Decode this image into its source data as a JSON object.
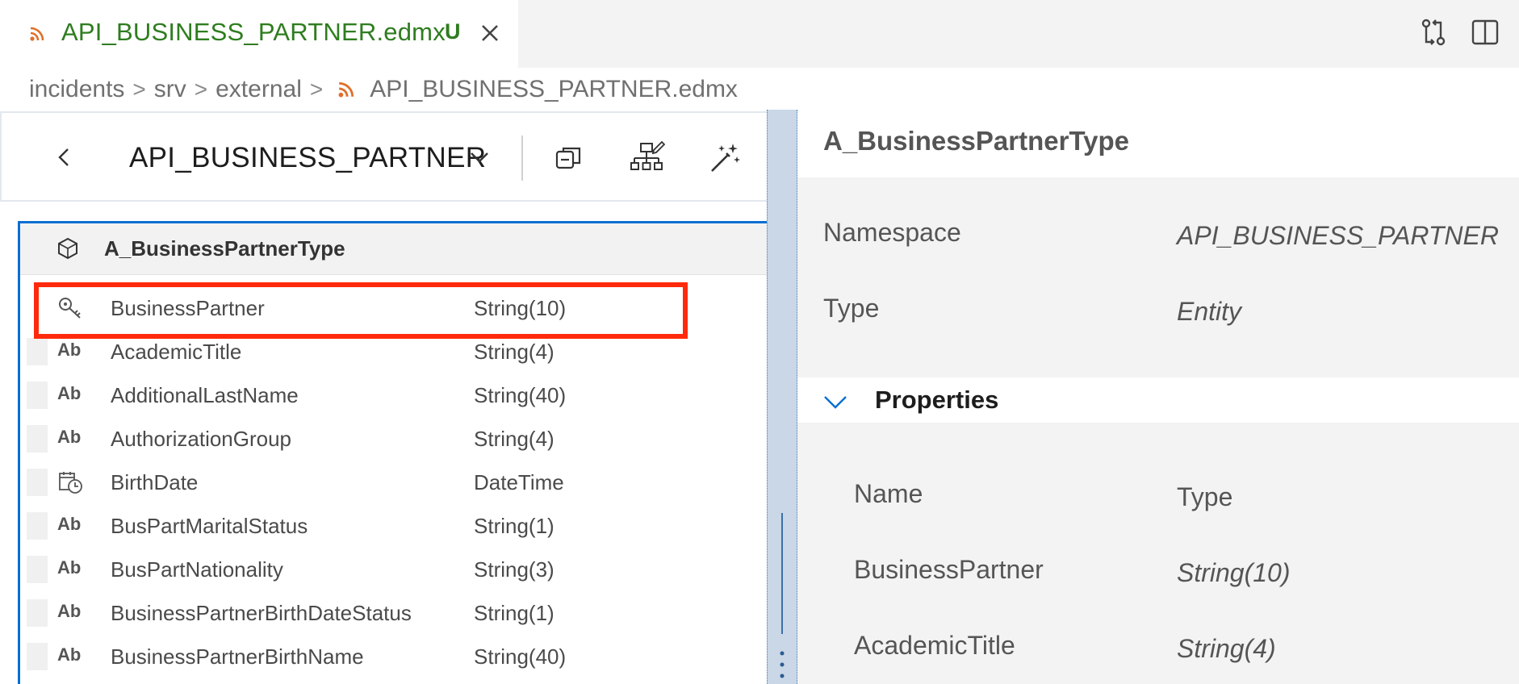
{
  "tab": {
    "title": "API_BUSINESS_PARTNER.edmx",
    "badge": "U"
  },
  "breadcrumb": {
    "items": [
      "incidents",
      "srv",
      "external"
    ],
    "file": "API_BUSINESS_PARTNER.edmx",
    "separator": ">"
  },
  "toolbar": {
    "service_title": "API_BUSINESS_PARTNER"
  },
  "entity": {
    "name": "A_BusinessPartnerType",
    "properties": [
      {
        "name": "BusinessPartner",
        "type": "String(10)",
        "icon": "key-icon"
      },
      {
        "name": "AcademicTitle",
        "type": "String(4)",
        "icon": "Ab"
      },
      {
        "name": "AdditionalLastName",
        "type": "String(40)",
        "icon": "Ab"
      },
      {
        "name": "AuthorizationGroup",
        "type": "String(4)",
        "icon": "Ab"
      },
      {
        "name": "BirthDate",
        "type": "DateTime",
        "icon": "calendar-clock-icon"
      },
      {
        "name": "BusPartMaritalStatus",
        "type": "String(1)",
        "icon": "Ab"
      },
      {
        "name": "BusPartNationality",
        "type": "String(3)",
        "icon": "Ab"
      },
      {
        "name": "BusinessPartnerBirthDateStatus",
        "type": "String(1)",
        "icon": "Ab"
      },
      {
        "name": "BusinessPartnerBirthName",
        "type": "String(40)",
        "icon": "Ab"
      }
    ]
  },
  "details": {
    "title": "A_BusinessPartnerType",
    "namespace_label": "Namespace",
    "namespace_value": "API_BUSINESS_PARTNER",
    "type_label": "Type",
    "type_value": "Entity",
    "properties_title": "Properties",
    "table": {
      "col_name": "Name",
      "col_type": "Type",
      "rows": [
        {
          "name": "BusinessPartner",
          "type": "String(10)"
        },
        {
          "name": "AcademicTitle",
          "type": "String(4)"
        }
      ]
    }
  },
  "colors": {
    "tab_text": "#2e7d1f",
    "rss_orange": "#e0702a",
    "selection_border": "#0a6ed1",
    "highlight": "#ff2a0c",
    "splitter": "#c9d7e6"
  }
}
